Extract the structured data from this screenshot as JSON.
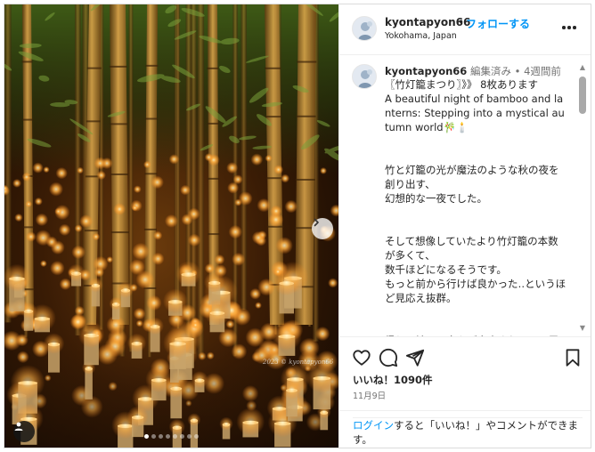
{
  "post": {
    "username": "kyontapyon66",
    "dot": "•",
    "follow_label": "フォローする",
    "location": "Yokohama, Japan",
    "more_icon": "more-horizontal-icon"
  },
  "caption": {
    "username": "kyontapyon66",
    "meta": "編集済み • 4週間前",
    "text": "〖竹灯籠まつり〗》》 8枚あります\nA beautiful night of bamboo and lanterns: Stepping into a mystical autumn world🎋🕯️\n\n\n竹と灯籠の光が魔法のような秋の夜を創り出す、\n幻想的な一夜でした。\n\n\nそして想像していたより竹灯籠の本数が多くて、\n数千ほどになるそうです。\nもっと前から行けば良かった‥というほど見応え抜群。\n\n\n帰りに地元の方々が出店されている屋台で、\n焼き鳥を買いましたが、すごく美味しかったです😋"
  },
  "engagement": {
    "likes": "いいね！1090件",
    "date": "11月9日",
    "icons": [
      "heart-icon",
      "comment-icon",
      "share-icon",
      "bookmark-icon"
    ]
  },
  "login_prompt": {
    "link": "ログイン",
    "text": "すると「いいね！」やコメントができます。"
  },
  "photo": {
    "watermark": "2023 © kyontapyon66",
    "carousel_total": 8,
    "carousel_index": 1
  },
  "colors": {
    "accent": "#0095f6",
    "text": "#262626",
    "muted": "#737373",
    "lantern": "#ffb347"
  }
}
